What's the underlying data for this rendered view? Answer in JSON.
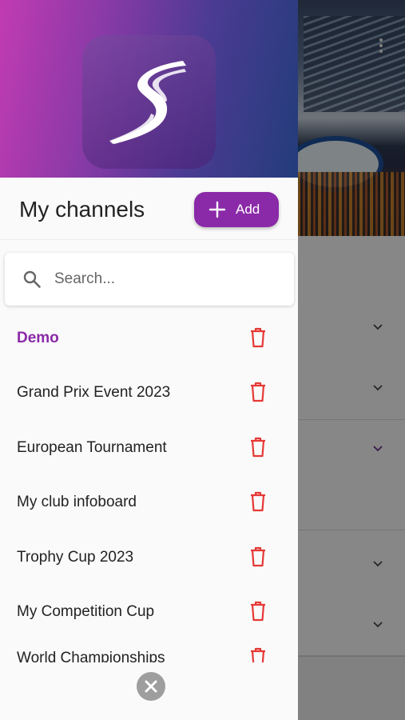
{
  "drawer": {
    "title": "My channels",
    "add_label": "Add",
    "search_placeholder": "Search...",
    "search_value": "",
    "channels": [
      {
        "label": "Demo",
        "active": true
      },
      {
        "label": "Grand Prix Event 2023",
        "active": false
      },
      {
        "label": "European Tournament",
        "active": false
      },
      {
        "label": "My club infoboard",
        "active": false
      },
      {
        "label": "Trophy Cup 2023",
        "active": false
      },
      {
        "label": "My Competition Cup",
        "active": false
      },
      {
        "label": "World Championships",
        "active": false
      }
    ]
  },
  "colors": {
    "accent": "#8a2aa8",
    "delete": "#e53935",
    "header_gradient_start": "#c13bb2",
    "header_gradient_end": "#233c7a"
  },
  "icons": {
    "logo": "app-logo-s",
    "add": "plus-icon",
    "search": "search-icon",
    "delete": "trash-icon",
    "close": "close-icon",
    "more": "more-vert-icon",
    "expand": "chevron-down-icon"
  }
}
